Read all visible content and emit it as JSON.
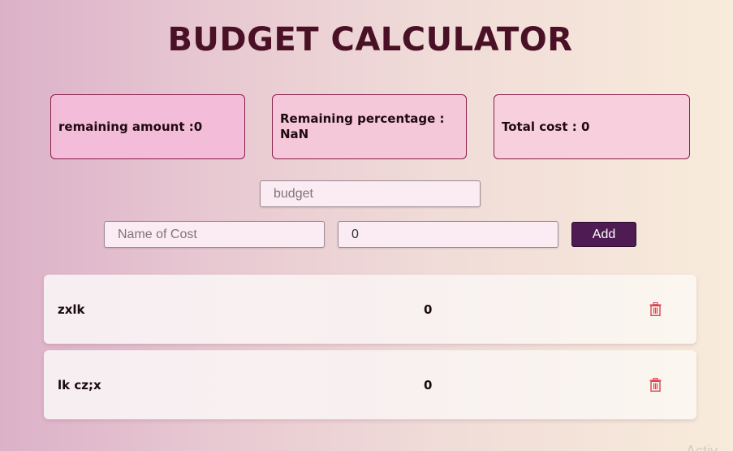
{
  "app": {
    "title": "BUDGET CALCULATOR"
  },
  "stats": {
    "remaining_amount": "remaining amount :0",
    "remaining_percentage": "Remaining percentage : NaN",
    "total_cost": "Total cost : 0"
  },
  "form": {
    "budget_placeholder": "budget",
    "budget_value": "",
    "name_placeholder": "Name of Cost",
    "name_value": "",
    "amount_value": "0",
    "add_label": "Add"
  },
  "costs": [
    {
      "name": "zxlk",
      "amount": "0"
    },
    {
      "name": "lk cz;x",
      "amount": "0"
    }
  ],
  "icons": {
    "delete": "trash-icon"
  },
  "colors": {
    "title": "#4a1126",
    "button": "#4e1b52",
    "delete_icon": "#e0454a",
    "stat_border": "#8a1e4c"
  },
  "watermark": "Activ"
}
